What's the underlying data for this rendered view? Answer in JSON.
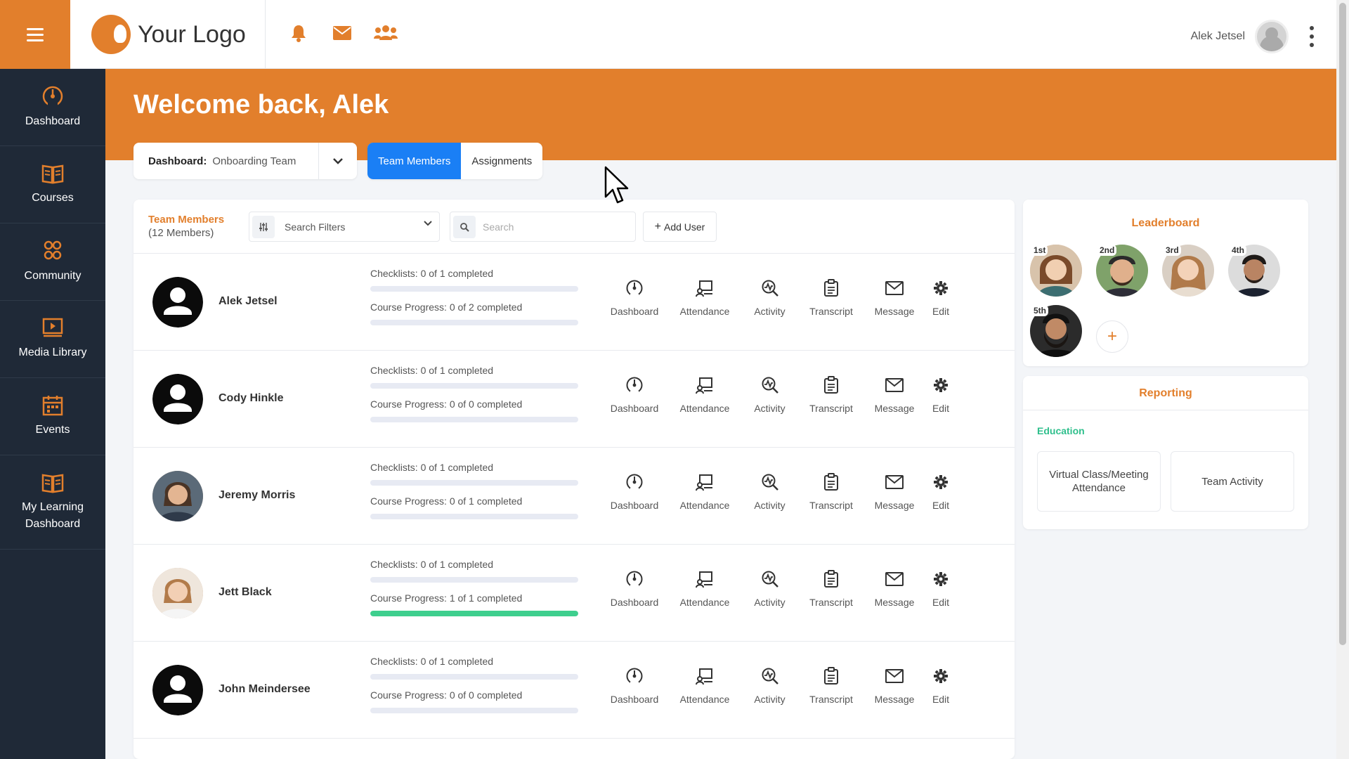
{
  "header": {
    "logo_text": "Your Logo",
    "user_name": "Alek Jetsel",
    "icons": [
      "bell-icon",
      "mail-icon",
      "users-icon"
    ]
  },
  "colors": {
    "accent": "#e27f2c",
    "sidebar": "#1f2937",
    "primary": "#1a7ff5",
    "success": "#3ecf8e",
    "education": "#2fbf8c"
  },
  "sidebar": {
    "items": [
      {
        "label": "Dashboard",
        "icon": "dashboard-icon"
      },
      {
        "label": "Courses",
        "icon": "book-icon"
      },
      {
        "label": "Community",
        "icon": "community-icon"
      },
      {
        "label": "Media Library",
        "icon": "media-icon"
      },
      {
        "label": "Events",
        "icon": "calendar-icon"
      },
      {
        "label": "My Learning Dashboard",
        "icon": "learning-icon"
      }
    ]
  },
  "banner": {
    "welcome": "Welcome back, Alek",
    "dashboard_label": "Dashboard:",
    "dashboard_value": "Onboarding Team",
    "tabs": [
      {
        "label": "Team Members",
        "active": true
      },
      {
        "label": "Assignments",
        "active": false
      }
    ]
  },
  "members": {
    "title": "Team Members",
    "count": "(12 Members)",
    "filter_label": "Search Filters",
    "search_placeholder": "Search",
    "add_user": "Add User",
    "action_labels": [
      "Dashboard",
      "Attendance",
      "Activity",
      "Transcript",
      "Message",
      "Edit"
    ],
    "rows": [
      {
        "name": "Alek Jetsel",
        "checklist": "Checklists: 0 of 1 completed",
        "checklist_pct": 0,
        "course": "Course Progress: 0 of 2 completed",
        "course_pct": 0
      },
      {
        "name": "Cody Hinkle",
        "checklist": "Checklists: 0 of 1 completed",
        "checklist_pct": 0,
        "course": "Course Progress: 0 of 0 completed",
        "course_pct": 0
      },
      {
        "name": "Jeremy Morris",
        "checklist": "Checklists: 0 of 1 completed",
        "checklist_pct": 0,
        "course": "Course Progress: 0 of 1 completed",
        "course_pct": 0
      },
      {
        "name": "Jett Black",
        "checklist": "Checklists: 0 of 1 completed",
        "checklist_pct": 0,
        "course": "Course Progress: 1 of 1 completed",
        "course_pct": 100
      },
      {
        "name": "John Meindersee",
        "checklist": "Checklists: 0 of 1 completed",
        "checklist_pct": 0,
        "course": "Course Progress: 0 of 0 completed",
        "course_pct": 0
      }
    ]
  },
  "leaderboard": {
    "title": "Leaderboard",
    "ranks": [
      "1st",
      "2nd",
      "3rd",
      "4th",
      "5th"
    ]
  },
  "reporting": {
    "title": "Reporting",
    "section": "Education",
    "cards": [
      "Virtual Class/Meeting Attendance",
      "Team Activity"
    ]
  }
}
